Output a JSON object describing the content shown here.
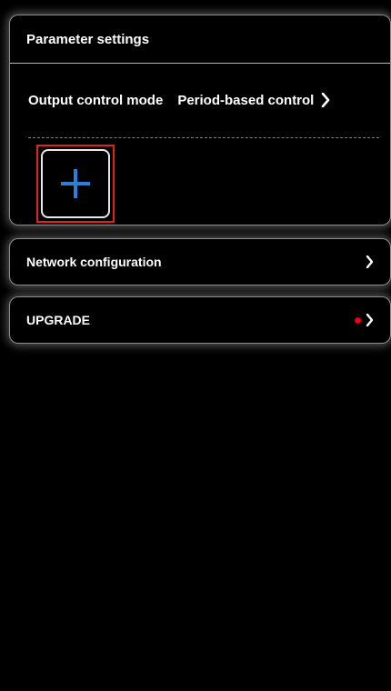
{
  "parameter_settings": {
    "title": "Parameter settings",
    "output_control": {
      "label": "Output control mode",
      "value": "Period-based control",
      "icon": "chevron-right-icon"
    },
    "add_button": {
      "icon": "plus-icon",
      "icon_color": "#2b7fd8",
      "highlight_color": "#e0231f"
    }
  },
  "menu": [
    {
      "label": "Network configuration",
      "icon": "chevron-right-icon"
    },
    {
      "label": "UPGRADE",
      "icon": "chevron-right-icon",
      "badge": "red-dot-icon",
      "badge_color": "#e8001c"
    }
  ]
}
